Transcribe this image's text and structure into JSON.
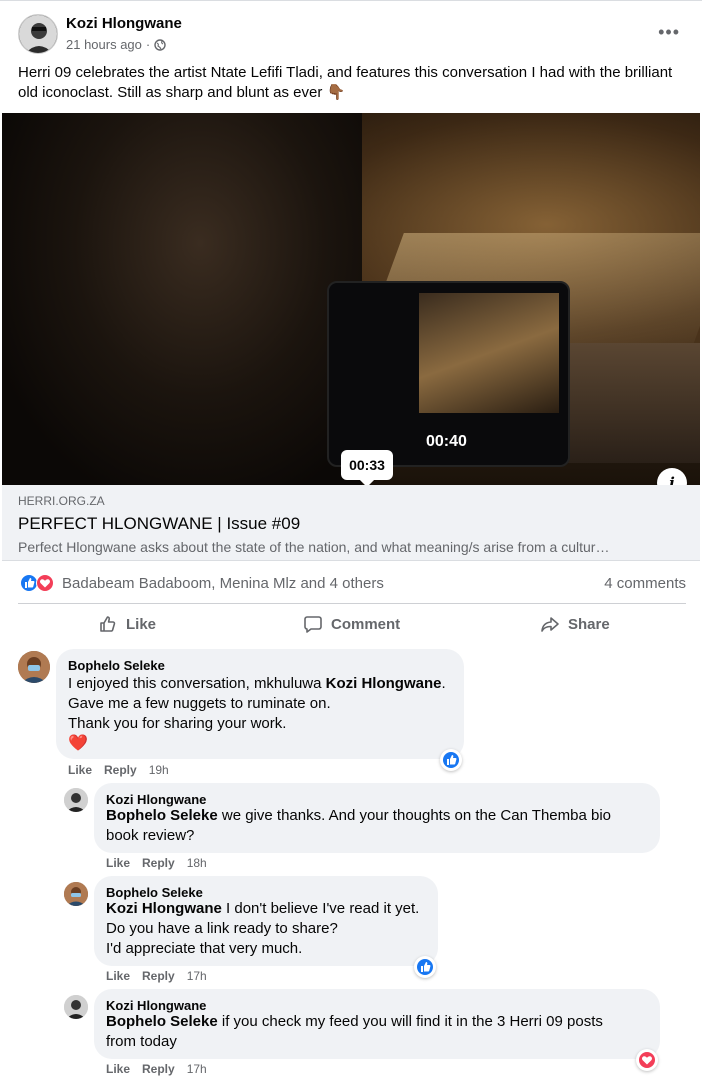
{
  "post": {
    "author": "Kozi Hlongwane",
    "time": "21 hours ago",
    "separator": "·",
    "more": "•••",
    "text": "Herri 09 celebrates the artist Ntate Lefifi Tladi, and features this conversation I had with the brilliant old iconoclast. Still as sharp and blunt as ever 👇🏾"
  },
  "video": {
    "current_time": "00:40",
    "hover_time": "00:33"
  },
  "link": {
    "domain": "HERRI.ORG.ZA",
    "title": "PERFECT HLONGWANE | Issue #09",
    "description": "Perfect Hlongwane asks about the state of the nation, and what meaning/s arise from a cultur…",
    "info_glyph": "i"
  },
  "reactions": {
    "names": "Badabeam Badaboom, Menina Mlz and 4 others",
    "comments": "4 comments"
  },
  "actions": {
    "like": "Like",
    "comment": "Comment",
    "share": "Share"
  },
  "comments": [
    {
      "author": "Bophelo Seleke",
      "line1_pre": "I enjoyed this conversation, mkhuluwa ",
      "line1_tag": "Kozi Hlongwane",
      "line1_post": ".",
      "line2": "Gave me a few nuggets to ruminate on.",
      "line3": "Thank you for sharing your work.",
      "line4": "❤️",
      "like": "Like",
      "reply": "Reply",
      "time": "19h"
    },
    {
      "author": "Kozi Hlongwane",
      "tag": "Bophelo Seleke",
      "line1": " we give thanks. And your thoughts on the Can Themba bio",
      "line2": "book review?",
      "like": "Like",
      "reply": "Reply",
      "time": "18h"
    },
    {
      "author": "Bophelo Seleke",
      "tag": "Kozi Hlongwane",
      "line1": " I don't believe I've read it yet.",
      "line2": "Do you have a link ready to share?",
      "line3": "I'd appreciate that very much.",
      "like": "Like",
      "reply": "Reply",
      "time": "17h"
    },
    {
      "author": "Kozi Hlongwane",
      "tag": "Bophelo Seleke",
      "line1": " if you check my feed you will find it in the 3 Herri 09 posts",
      "line2": "from today",
      "like": "Like",
      "reply": "Reply",
      "time": "17h"
    }
  ],
  "colors": {
    "like_blue": "#1877f2",
    "love_red": "#f33e58",
    "bubble_bg": "#f0f2f5",
    "secondary_text": "#65676b"
  }
}
